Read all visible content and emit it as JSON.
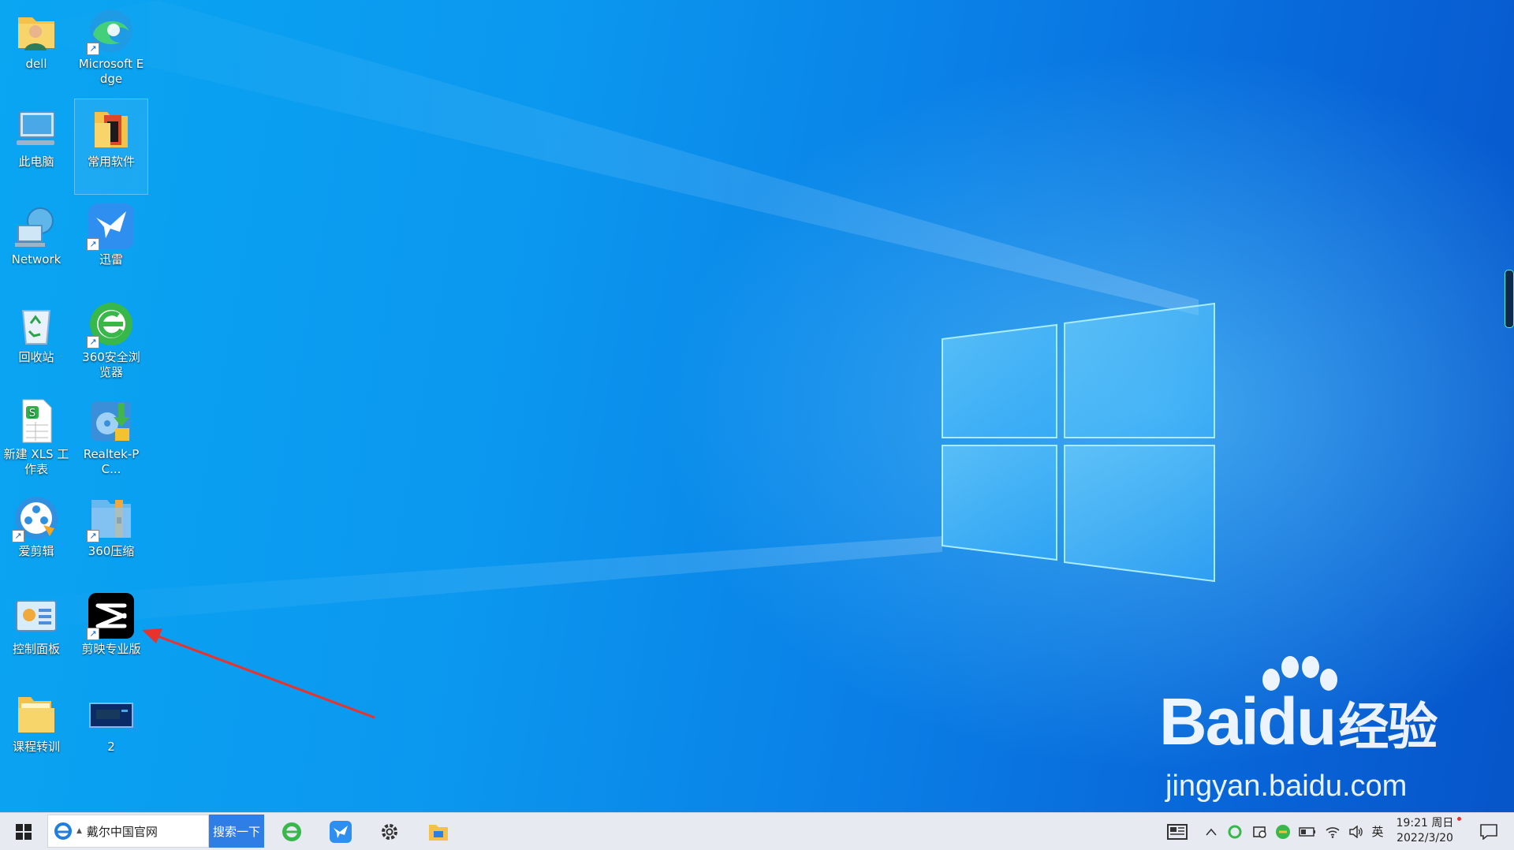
{
  "desktop": {
    "icons": [
      {
        "label": "dell"
      },
      {
        "label": "Microsoft Edge"
      },
      {
        "label": "此电脑"
      },
      {
        "label": "常用软件"
      },
      {
        "label": "Network"
      },
      {
        "label": "迅雷"
      },
      {
        "label": "回收站"
      },
      {
        "label": "360安全浏览器"
      },
      {
        "label": "新建 XLS 工作表"
      },
      {
        "label": "Realtek-PC..."
      },
      {
        "label": "爱剪辑"
      },
      {
        "label": "360压缩"
      },
      {
        "label": "控制面板"
      },
      {
        "label": "剪映专业版"
      },
      {
        "label": "课程转训"
      },
      {
        "label": "2"
      }
    ]
  },
  "watermark": {
    "brand": "Bai",
    "brand_paw": "du",
    "brand_cn": "经验",
    "url": "jingyan.baidu.com"
  },
  "taskbar": {
    "search_text": "戴尔中国官网",
    "search_button": "搜索一下",
    "ime": "英",
    "time": "19:21 周日",
    "date": "2022/3/20"
  },
  "colors": {
    "desktop_blue": "#0a8ff0",
    "taskbar": "#e7ebf1",
    "arrow": "#e8332c",
    "search_button": "#2f7ee6"
  }
}
